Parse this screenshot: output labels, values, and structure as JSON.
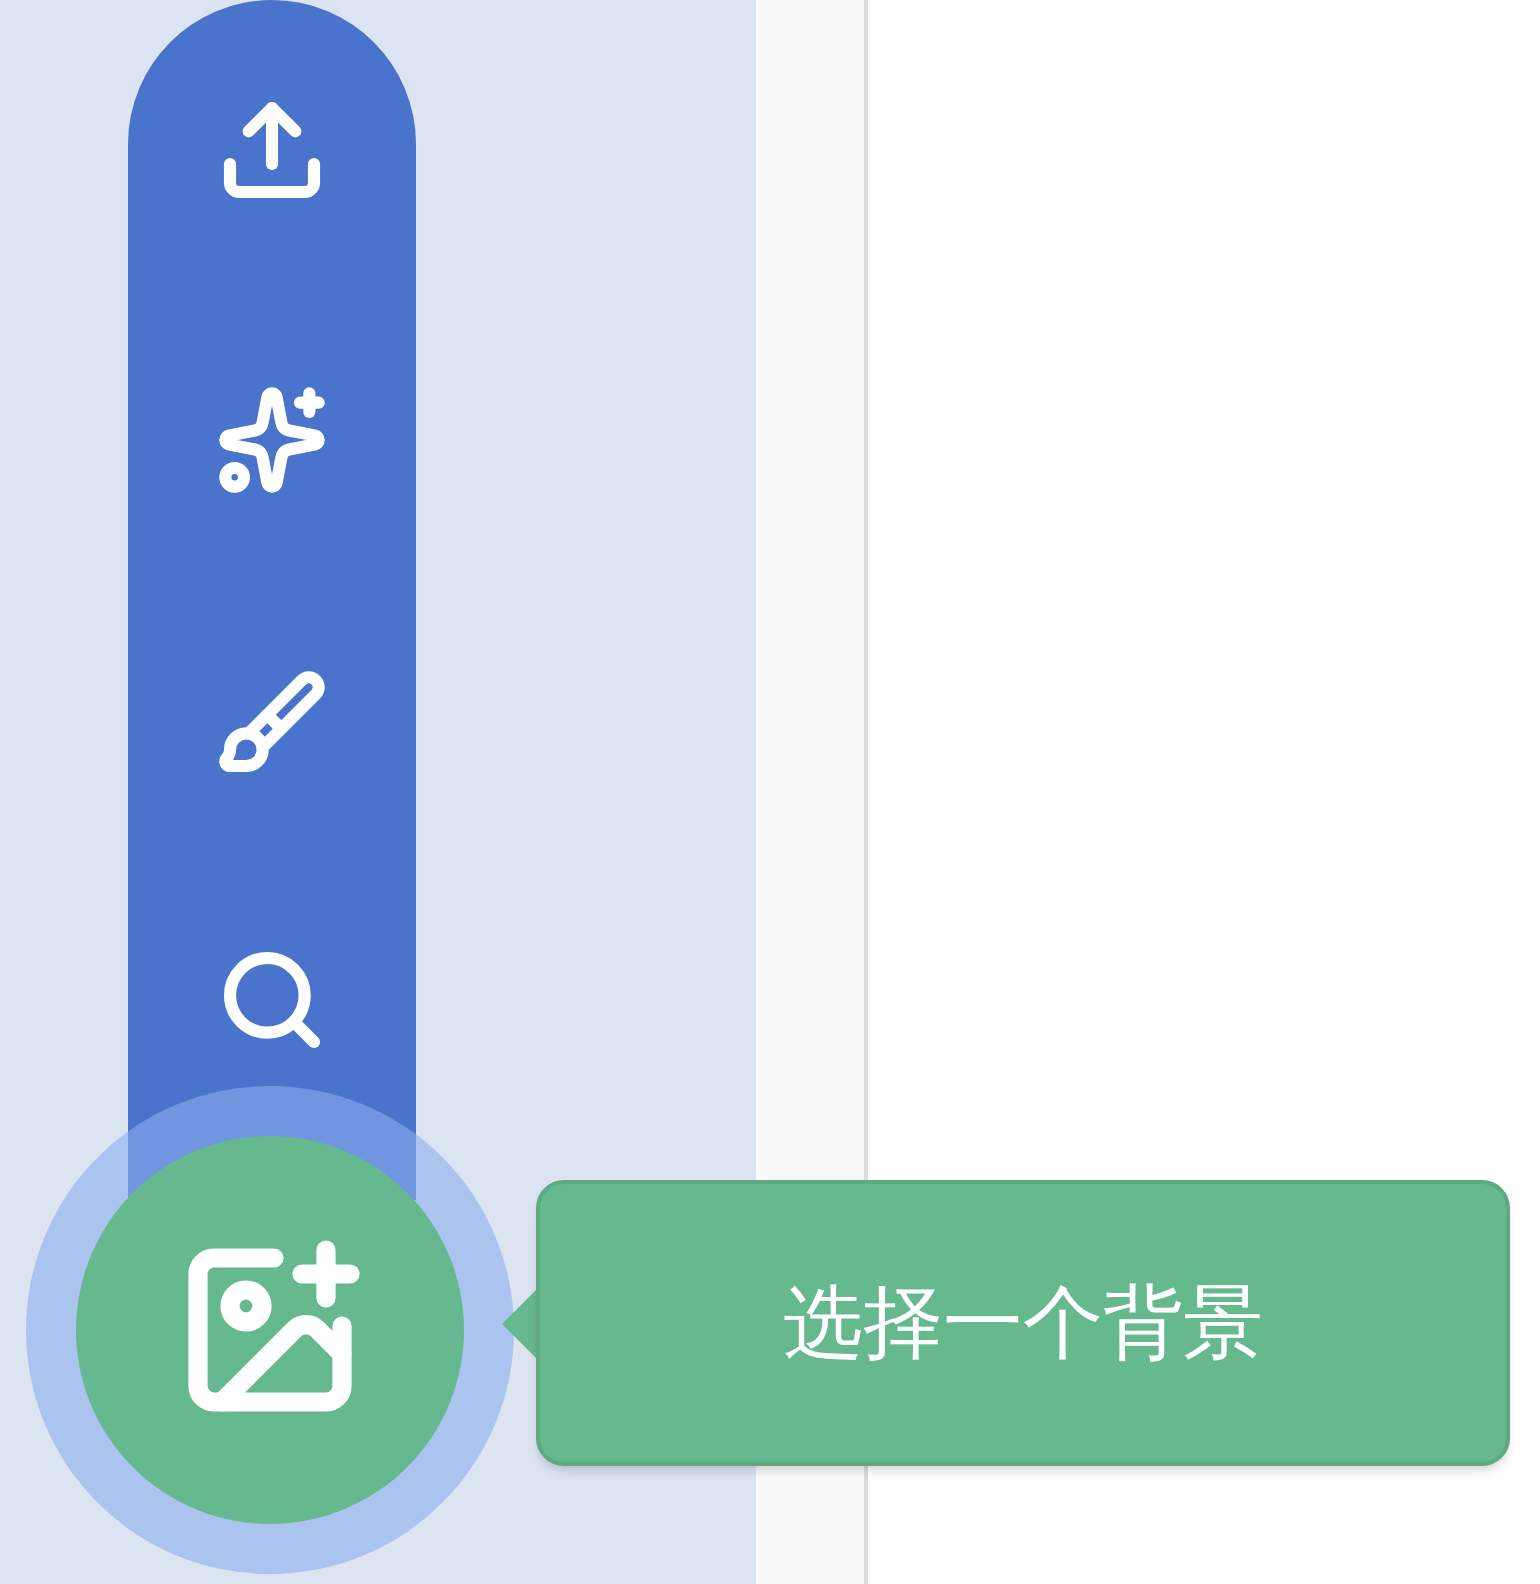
{
  "backdrop_menu": {
    "tooltip": "选择一个背景"
  }
}
